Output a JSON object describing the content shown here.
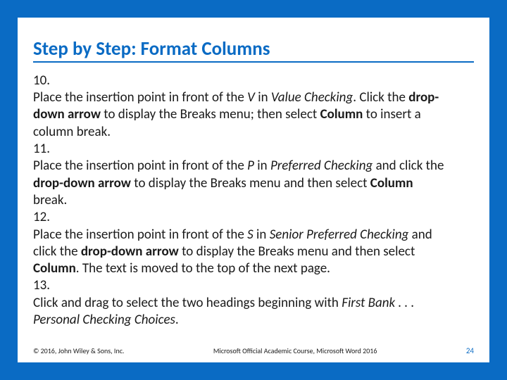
{
  "slide": {
    "title": "Step by Step: Format Columns",
    "steps": [
      {
        "num": "10.",
        "html": "Place the insertion point in front of the <em class='i'>V</em> in <em class='i'>Value Checking</em>. Click the <strong class='b'>drop-down arrow</strong> to display the Breaks menu; then select <strong class='b'>Column</strong> to insert a column break."
      },
      {
        "num": "11.",
        "html": "Place the insertion point in front of the <em class='i'>P</em> in <em class='i'>Preferred Checking</em> and click the <strong class='b'>drop-down arrow</strong> to display the Breaks menu and then select <strong class='b'>Column</strong> break."
      },
      {
        "num": "12.",
        "html": "Place the insertion point in front of the <em class='i'>S</em> in <em class='i'>Senior Preferred Checking</em> and click the <strong class='b'>drop-down arrow</strong> to display the Breaks menu and then select <strong class='b'>Column</strong>. The text is moved to the top of the next page."
      },
      {
        "num": "13.",
        "html": "Click and drag to select the two headings beginning with <em class='i'>First Bank . . . Personal Checking Choices</em>."
      }
    ],
    "footer": {
      "left": "© 2016, John Wiley & Sons, Inc.",
      "center": "Microsoft Official Academic Course, Microsoft Word 2016",
      "right": "24"
    }
  }
}
